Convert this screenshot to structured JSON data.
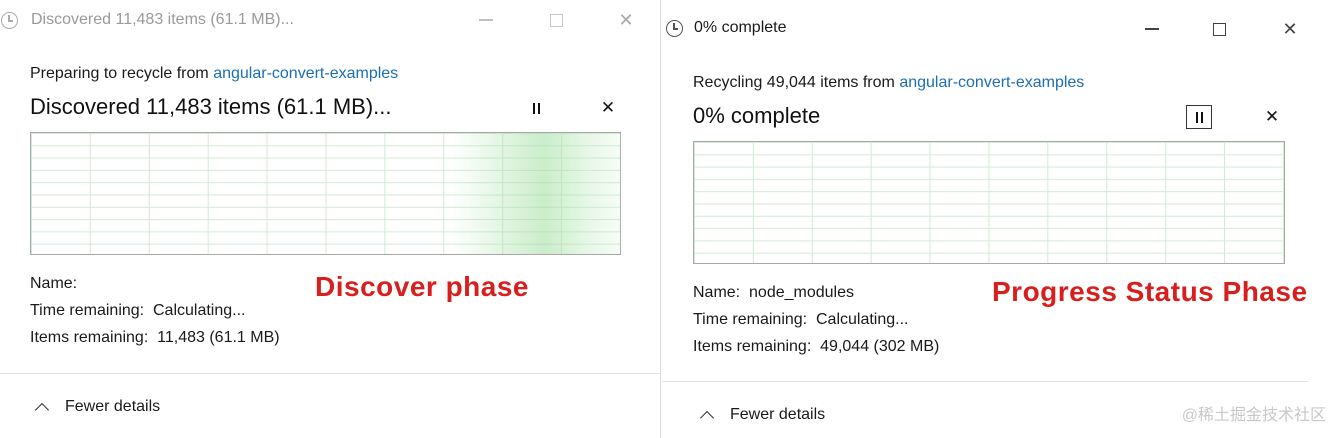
{
  "left_window": {
    "title": "Discovered 11,483 items (61.1 MB)...",
    "line1_prefix": "Preparing to recycle from ",
    "line1_link": "angular-convert-examples",
    "status": "Discovered 11,483 items (61.1 MB)...",
    "name_label": "Name:",
    "name_value": "",
    "time_label": "Time remaining:",
    "time_value": "Calculating...",
    "items_label": "Items remaining:",
    "items_value": "11,483 (61.1 MB)",
    "fewer_details": "Fewer details",
    "annotation": "Discover phase"
  },
  "right_window": {
    "title": "0% complete",
    "line1_prefix": "Recycling 49,044 items from ",
    "line1_link": "angular-convert-examples",
    "status": "0% complete",
    "progress_percent": 0,
    "name_label": "Name:",
    "name_value": "node_modules",
    "time_label": "Time remaining:",
    "time_value": "Calculating...",
    "items_label": "Items remaining:",
    "items_value": "49,044 (302 MB)",
    "fewer_details": "Fewer details",
    "annotation": "Progress Status Phase"
  },
  "watermark": "@稀土掘金技术社区",
  "colors": {
    "link": "#1a6fb5",
    "annotation": "#d91e1e",
    "graph_grid": "#d2ead6",
    "graph_glow": "#a0dea0"
  },
  "icons": {
    "title": "clock-icon",
    "pause": "pause-icon",
    "stop": "close-icon",
    "expand": "chevron-up-icon"
  }
}
